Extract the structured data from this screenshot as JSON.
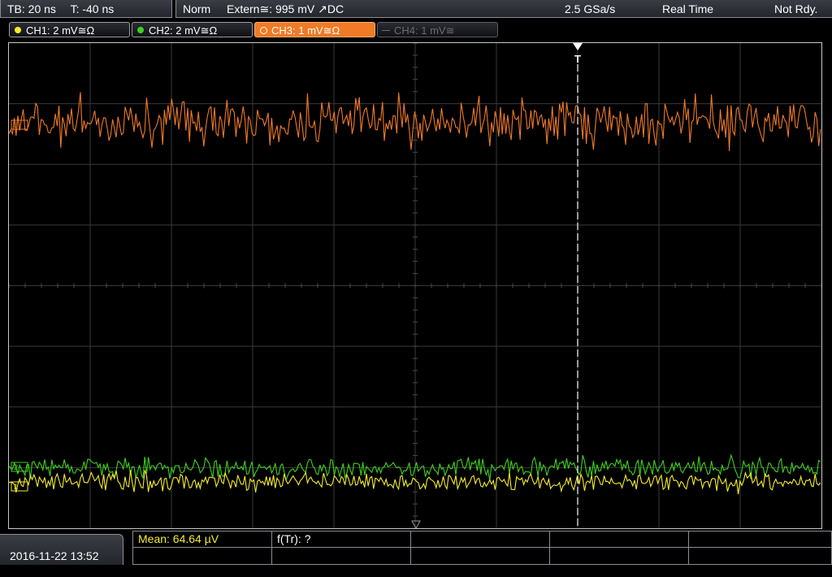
{
  "status": {
    "timebase": "TB: 20 ns",
    "trigger_time": "T: -40 ns",
    "mode": "Norm",
    "trigger_source": "Extern≅: 995 mV ↗DC",
    "sample_rate": "2.5 GSa/s",
    "acq_mode": "Real Time",
    "state": "Not Rdy."
  },
  "channels": [
    {
      "id": "ch1",
      "label": "CH1: 2 mV≅Ω",
      "color": "#f5ec2a",
      "state": "on"
    },
    {
      "id": "ch2",
      "label": "CH2: 2 mV≅Ω",
      "color": "#3fd11e",
      "state": "on"
    },
    {
      "id": "ch3",
      "label": "CH3: 1 mV≅Ω",
      "color": "#f07a26",
      "state": "active"
    },
    {
      "id": "ch4",
      "label": "CH4: 1 mV≅",
      "color": "#6a6c72",
      "state": "off"
    }
  ],
  "trigger_marker": "T",
  "colors": {
    "ch1": "#f5ec2a",
    "ch2": "#3fd11e",
    "ch3": "#f07a26",
    "grid": "#3a3a3a",
    "trigger": "#ffffff"
  },
  "bottom": {
    "datetime": "2016-11-22 13:52",
    "measure_mean": "Mean: 64.64 µV",
    "measure_ftr": "f(Tr): ?"
  },
  "icons": [
    "channel-level-marker-icon",
    "trigger-position-marker-icon",
    "trigger-level-marker-icon"
  ]
}
